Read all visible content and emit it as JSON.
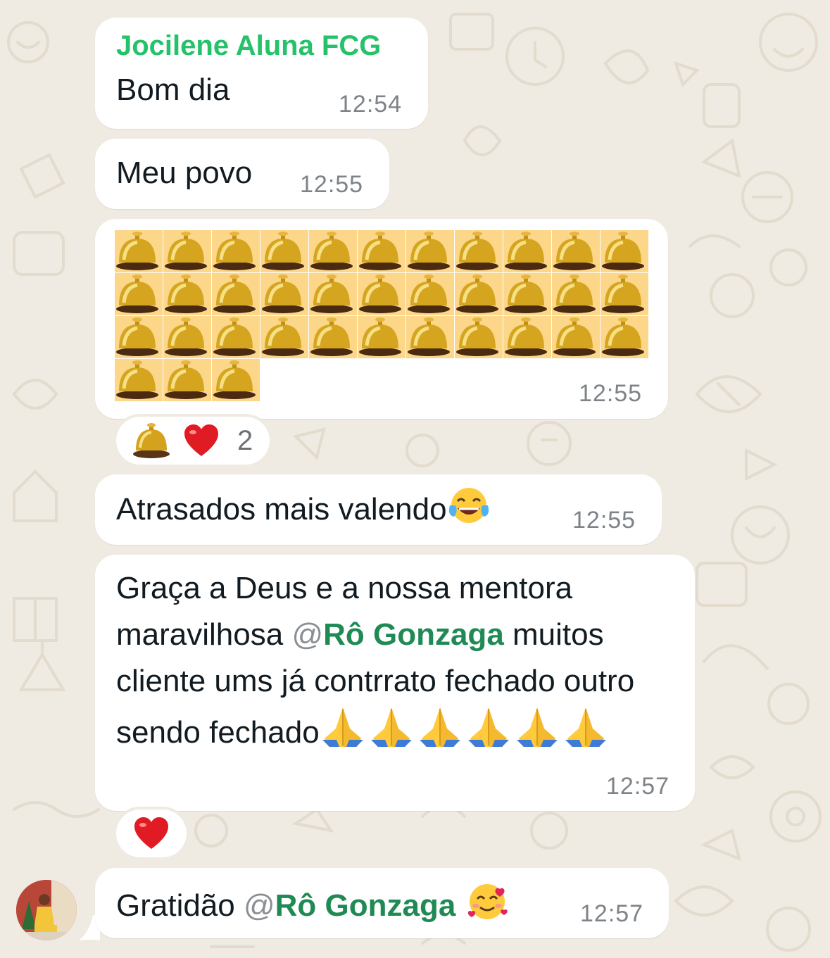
{
  "messages": [
    {
      "sender": "Jocilene Aluna FCG",
      "text": "Bom dia",
      "time": "12:54"
    },
    {
      "text": "Meu povo",
      "time": "12:55"
    },
    {
      "emoji": "bellhop-bell",
      "emoji_count": 36,
      "time": "12:55"
    },
    {
      "text": "Atrasados mais valendo",
      "time": "12:55"
    },
    {
      "text_before": "Graça a Deus e a nossa mentora maravilhosa ",
      "mention_at": "@",
      "mention_name": "Rô Gonzaga",
      "text_after": " muitos cliente ums já contrrato fechado outro sendo fechado",
      "time": "12:57"
    },
    {
      "text_before": "Gratidão ",
      "mention_at": "@",
      "mention_name": "Rô Gonzaga",
      "time": "12:57"
    }
  ],
  "reactions": [
    {
      "emojis": [
        "bellhop-bell-icon",
        "red-heart-icon"
      ],
      "count": "2"
    },
    {
      "emojis": [
        "red-heart-icon"
      ]
    }
  ],
  "colors": {
    "background": "#efeae2",
    "bubble": "#ffffff",
    "sender_name": "#25c26a",
    "mention": "#1f8a54",
    "timestamp": "#7d8388"
  }
}
